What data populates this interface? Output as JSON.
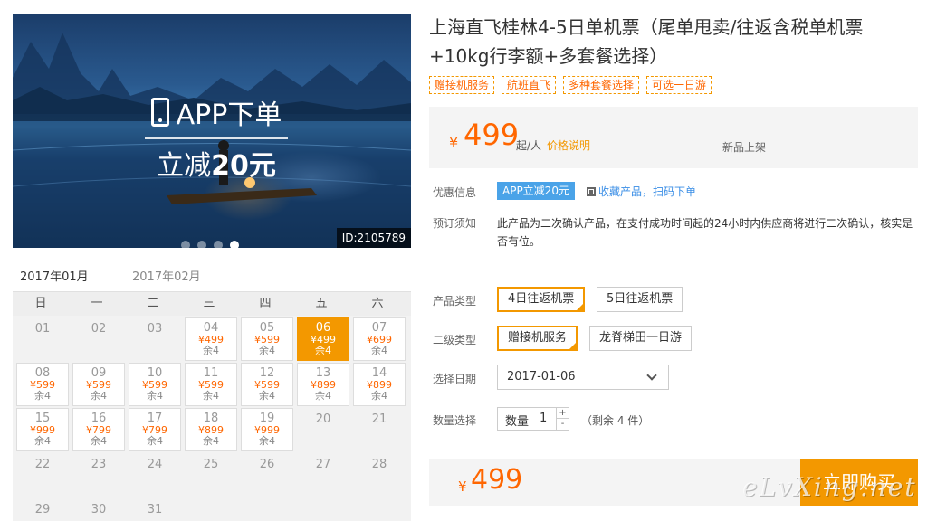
{
  "banner": {
    "promo_line1": "APP下单",
    "promo_line2_prefix": "立减",
    "promo_line2_amount": "20元",
    "id_tag": "ID:2105789",
    "dots": 4,
    "active_dot": 4
  },
  "calendar": {
    "tabs": [
      "2017年01月",
      "2017年02月"
    ],
    "active_tab": 0,
    "weekdays": [
      "日",
      "一",
      "二",
      "三",
      "四",
      "五",
      "六"
    ],
    "currency": "¥",
    "remain_prefix": "余",
    "cells": [
      {
        "d": "01"
      },
      {
        "d": "02"
      },
      {
        "d": "03"
      },
      {
        "d": "04",
        "p": "499",
        "r": "4"
      },
      {
        "d": "05",
        "p": "599",
        "r": "4"
      },
      {
        "d": "06",
        "p": "499",
        "r": "4",
        "selected": true
      },
      {
        "d": "07",
        "p": "699",
        "r": "4"
      },
      {
        "d": "08",
        "p": "599",
        "r": "4"
      },
      {
        "d": "09",
        "p": "599",
        "r": "4"
      },
      {
        "d": "10",
        "p": "599",
        "r": "4"
      },
      {
        "d": "11",
        "p": "599",
        "r": "4"
      },
      {
        "d": "12",
        "p": "599",
        "r": "4"
      },
      {
        "d": "13",
        "p": "899",
        "r": "4"
      },
      {
        "d": "14",
        "p": "899",
        "r": "4"
      },
      {
        "d": "15",
        "p": "999",
        "r": "4"
      },
      {
        "d": "16",
        "p": "799",
        "r": "4"
      },
      {
        "d": "17",
        "p": "799",
        "r": "4"
      },
      {
        "d": "18",
        "p": "899",
        "r": "4"
      },
      {
        "d": "19",
        "p": "999",
        "r": "4"
      },
      {
        "d": "20"
      },
      {
        "d": "21"
      },
      {
        "d": "22"
      },
      {
        "d": "23"
      },
      {
        "d": "24"
      },
      {
        "d": "25"
      },
      {
        "d": "26"
      },
      {
        "d": "27"
      },
      {
        "d": "28"
      },
      {
        "d": "29"
      },
      {
        "d": "30"
      },
      {
        "d": "31"
      }
    ]
  },
  "product": {
    "title": "上海直飞桂林4-5日单机票（尾单甩卖/往返含税单机票+10kg行李额+多套餐选择）",
    "tags": [
      "赠接机服务",
      "航班直飞",
      "多种套餐选择",
      "可选一日游"
    ],
    "price": {
      "currency": "¥",
      "amount": "499",
      "unit": "起/人",
      "explain_link": "价格说明",
      "new_tag": "新品上架"
    },
    "discount_label": "优惠信息",
    "discount_badge": "APP立减20元",
    "qr_link": "收藏产品，扫码下单",
    "notice_label": "预订须知",
    "notice_text": "此产品为二次确认产品，在支付成功时间起的24小时内供应商将进行二次确认，核实是否有位。",
    "type_label": "产品类型",
    "types": [
      "4日往返机票",
      "5日往返机票"
    ],
    "subtype_label": "二级类型",
    "subtypes": [
      "赠接机服务",
      "龙脊梯田一日游"
    ],
    "date_label": "选择日期",
    "date_value": "2017-01-06",
    "qty_label": "数量选择",
    "qty_inner_label": "数量",
    "qty_value": "1",
    "qty_plus": "+",
    "qty_minus": "-",
    "remain_text": "（剩余 4 件）",
    "total_currency": "¥",
    "total_amount": "499",
    "buy_button": "立即购买"
  },
  "watermark": "eLvXing.net"
}
